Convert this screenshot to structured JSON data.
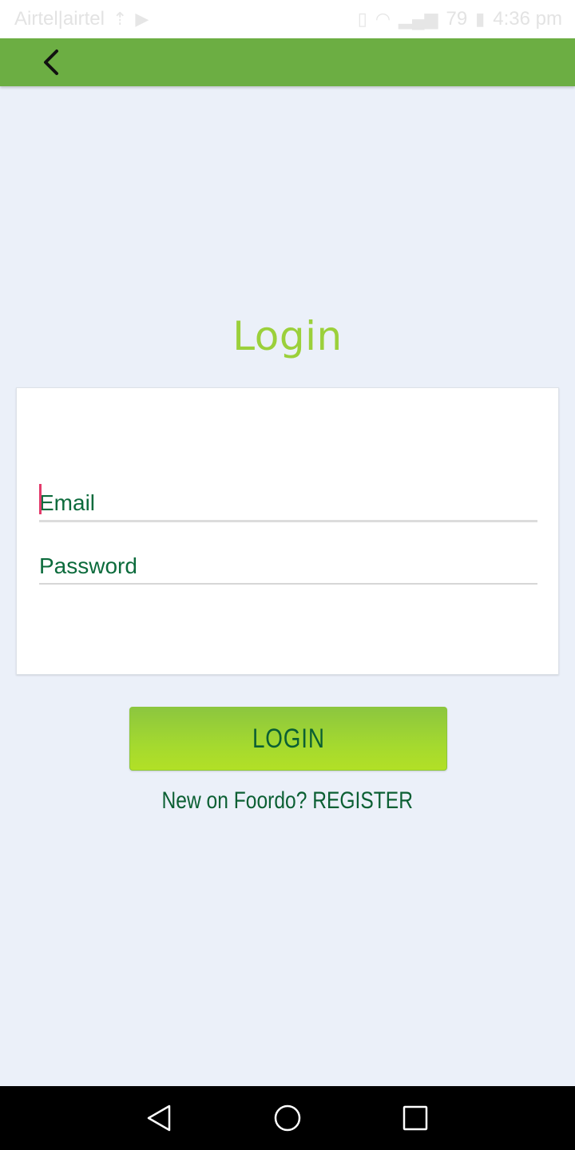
{
  "status_bar": {
    "carrier": "Airtel|airtel",
    "time": "4:36 pm",
    "battery": "79"
  },
  "app_bar": {
    "back_icon": "chevron-left-icon"
  },
  "page": {
    "title": "Login"
  },
  "form": {
    "email_placeholder": "Email",
    "email_value": "",
    "password_placeholder": "Password",
    "password_value": ""
  },
  "actions": {
    "login_label": "LOGIN",
    "register_text": "New on Foordo? REGISTER"
  },
  "colors": {
    "app_bar": "#6cae43",
    "title": "#9bd03b",
    "text_dark_green": "#0b5f33",
    "caret": "#e33a6b",
    "background": "#ebf0f9"
  },
  "nav_bar": {
    "back": "nav-back-icon",
    "home": "nav-home-icon",
    "recents": "nav-recents-icon"
  }
}
